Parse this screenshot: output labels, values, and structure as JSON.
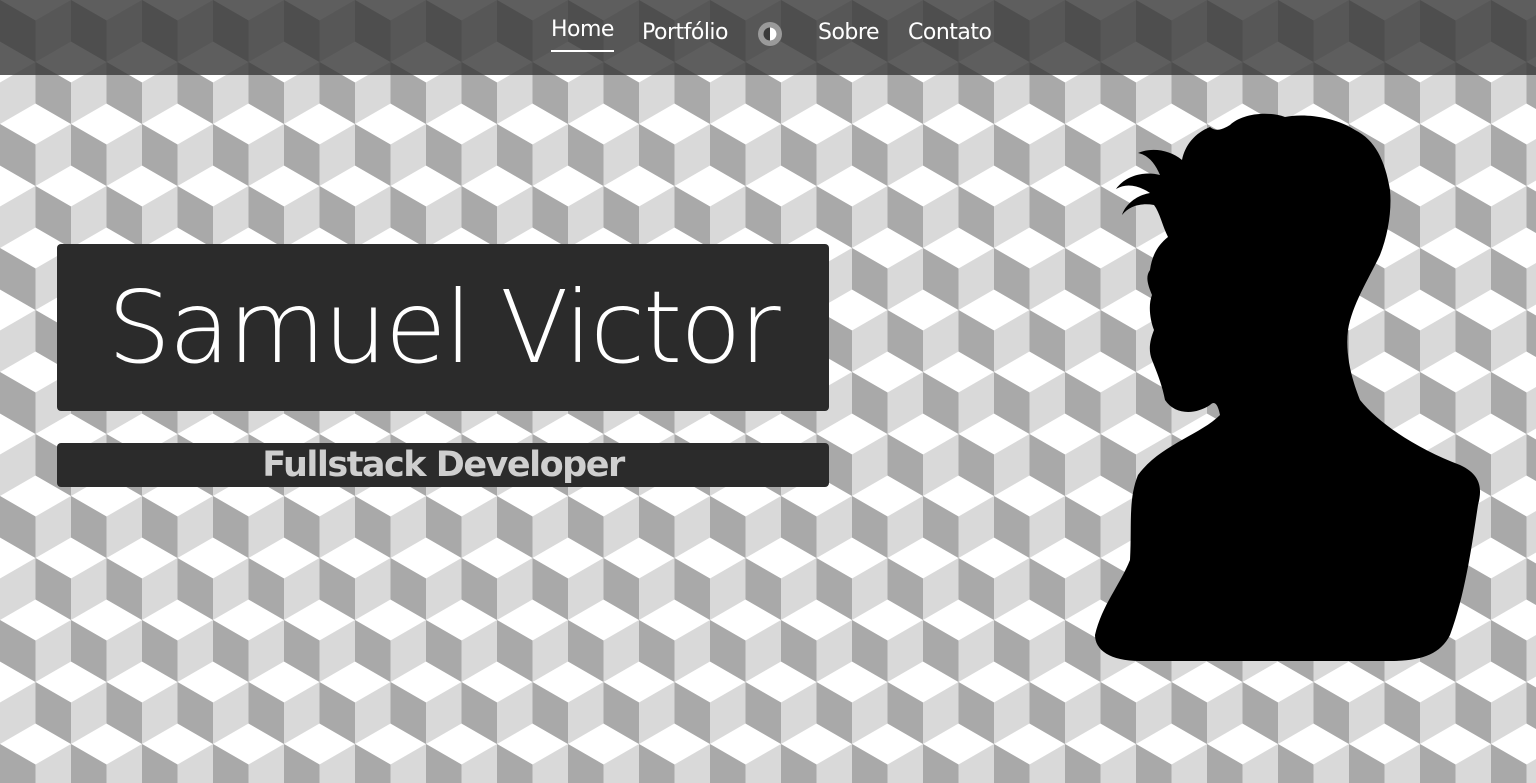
{
  "nav": {
    "items": [
      {
        "label": "Home",
        "active": true
      },
      {
        "label": "Portfólio",
        "active": false
      },
      {
        "label": "Sobre",
        "active": false
      },
      {
        "label": "Contato",
        "active": false
      }
    ],
    "theme_toggle_icon": "contrast-icon"
  },
  "hero": {
    "name": "Samuel Victor",
    "role": "Fullstack Developer",
    "portrait_icon": "profile-silhouette"
  },
  "colors": {
    "navbar": "#3a3a3a",
    "name_box": "#2b2b2b",
    "role_text": "#cfcfcf",
    "cube_light": "#ffffff",
    "cube_mid": "#d9d9d9",
    "cube_dark": "#a9a9a9"
  }
}
